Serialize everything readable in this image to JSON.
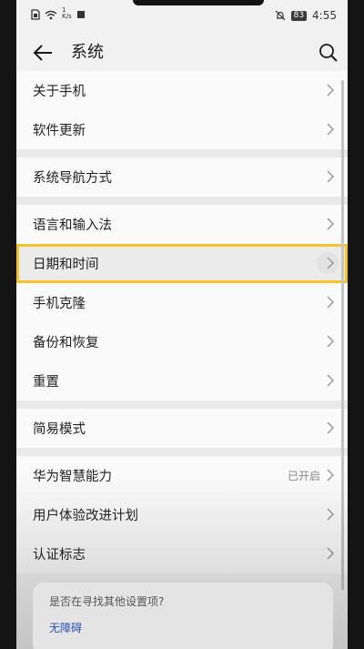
{
  "status_bar": {
    "net_speed_value": "1",
    "net_speed_unit": "K/s",
    "battery": "83",
    "time": "4:55"
  },
  "header": {
    "title": "系统"
  },
  "groups": [
    {
      "items": [
        {
          "label": "关于手机"
        },
        {
          "label": "软件更新"
        }
      ]
    },
    {
      "items": [
        {
          "label": "系统导航方式"
        }
      ]
    },
    {
      "items": [
        {
          "label": "语言和输入法"
        },
        {
          "label": "日期和时间",
          "highlighted": true
        },
        {
          "label": "手机克隆"
        },
        {
          "label": "备份和恢复"
        },
        {
          "label": "重置"
        }
      ]
    },
    {
      "items": [
        {
          "label": "简易模式"
        }
      ]
    },
    {
      "items": [
        {
          "label": "华为智慧能力",
          "value": "已开启"
        },
        {
          "label": "用户体验改进计划"
        },
        {
          "label": "认证标志"
        }
      ]
    }
  ],
  "suggestion": {
    "question": "是否在寻找其他设置项?",
    "link": "无障碍"
  },
  "colors": {
    "highlight_border": "#f6c22d",
    "link": "#2b4fb5"
  },
  "icons": [
    "back-arrow-icon",
    "search-icon",
    "chevron-right-icon",
    "sim-icon",
    "wifi-icon",
    "mute-bell-icon",
    "battery-icon"
  ]
}
